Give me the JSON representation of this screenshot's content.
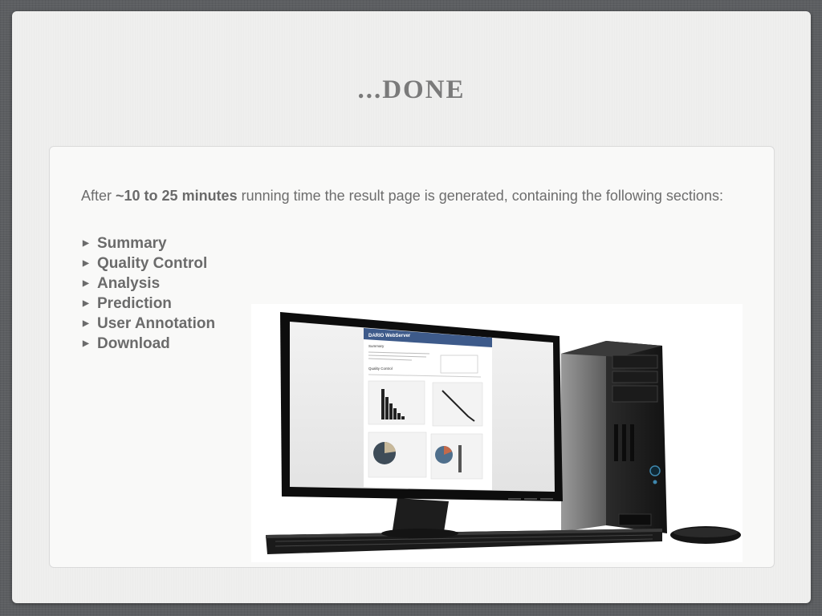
{
  "slide": {
    "title": "...DONE",
    "intro": {
      "prefix": "After ",
      "highlight": "~10 to 25 minutes",
      "suffix": " running time the result page is generated, containing the following sections:"
    },
    "sections": [
      {
        "label": "Summary"
      },
      {
        "label": "Quality Control"
      },
      {
        "label": "Analysis"
      },
      {
        "label": "Prediction"
      },
      {
        "label": "User Annotation"
      },
      {
        "label": "Download"
      }
    ],
    "bullet_icon": "triangle-right-icon",
    "screen": {
      "brand": "DARIO WebServer",
      "heading_summary": "Summary",
      "heading_qc": "Quality Control"
    }
  }
}
